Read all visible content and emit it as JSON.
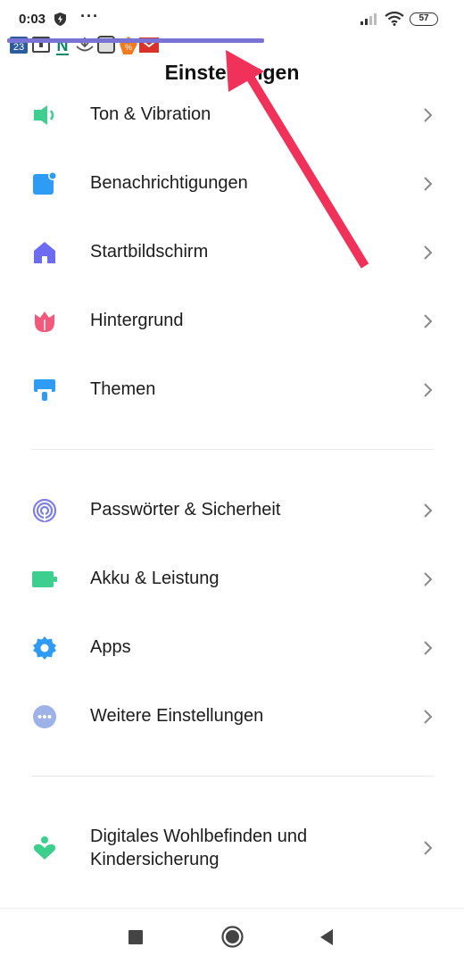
{
  "status_bar": {
    "time": "0:03",
    "overflow": "···",
    "battery_level": "57",
    "icons": [
      "shield-bolt-icon",
      "signal-icon",
      "wifi-icon",
      "battery-icon"
    ]
  },
  "notification_icons": [
    "calendar-icon",
    "box-icon",
    "n-app-icon",
    "download-icon",
    "square-app-icon",
    "percent-app-icon",
    "mail-icon"
  ],
  "page": {
    "title": "Einstellungen"
  },
  "settings": {
    "group1": [
      {
        "label": "Ton & Vibration",
        "icon": "speaker-icon",
        "color": "#3ecf8e"
      },
      {
        "label": "Benachrichtigungen",
        "icon": "notification-icon",
        "color": "#2e9bf5"
      },
      {
        "label": "Startbildschirm",
        "icon": "home-icon",
        "color": "#6b6cf2"
      },
      {
        "label": "Hintergrund",
        "icon": "tulip-icon",
        "color": "#f4587b"
      },
      {
        "label": "Themen",
        "icon": "paintbrush-icon",
        "color": "#2e9bf5"
      }
    ],
    "group2": [
      {
        "label": "Passwörter & Sicherheit",
        "icon": "fingerprint-icon",
        "color": "#7b7fe6"
      },
      {
        "label": "Akku & Leistung",
        "icon": "battery-icon",
        "color": "#3ecf8e"
      },
      {
        "label": "Apps",
        "icon": "gear-icon",
        "color": "#2e9bf5"
      },
      {
        "label": "Weitere Einstellungen",
        "icon": "more-icon",
        "color": "#9fb2e8"
      }
    ],
    "group3": [
      {
        "label_line1": "Digitales Wohlbefinden und",
        "label_line2": "Kindersicherung",
        "icon": "wellbeing-icon",
        "color": "#3ecf8e"
      }
    ]
  },
  "nav_bar": {
    "buttons": [
      "recents-button",
      "home-button",
      "back-button"
    ]
  },
  "colors": {
    "accent_line": "#7a73d6",
    "annotation_arrow": "#f0325a"
  }
}
